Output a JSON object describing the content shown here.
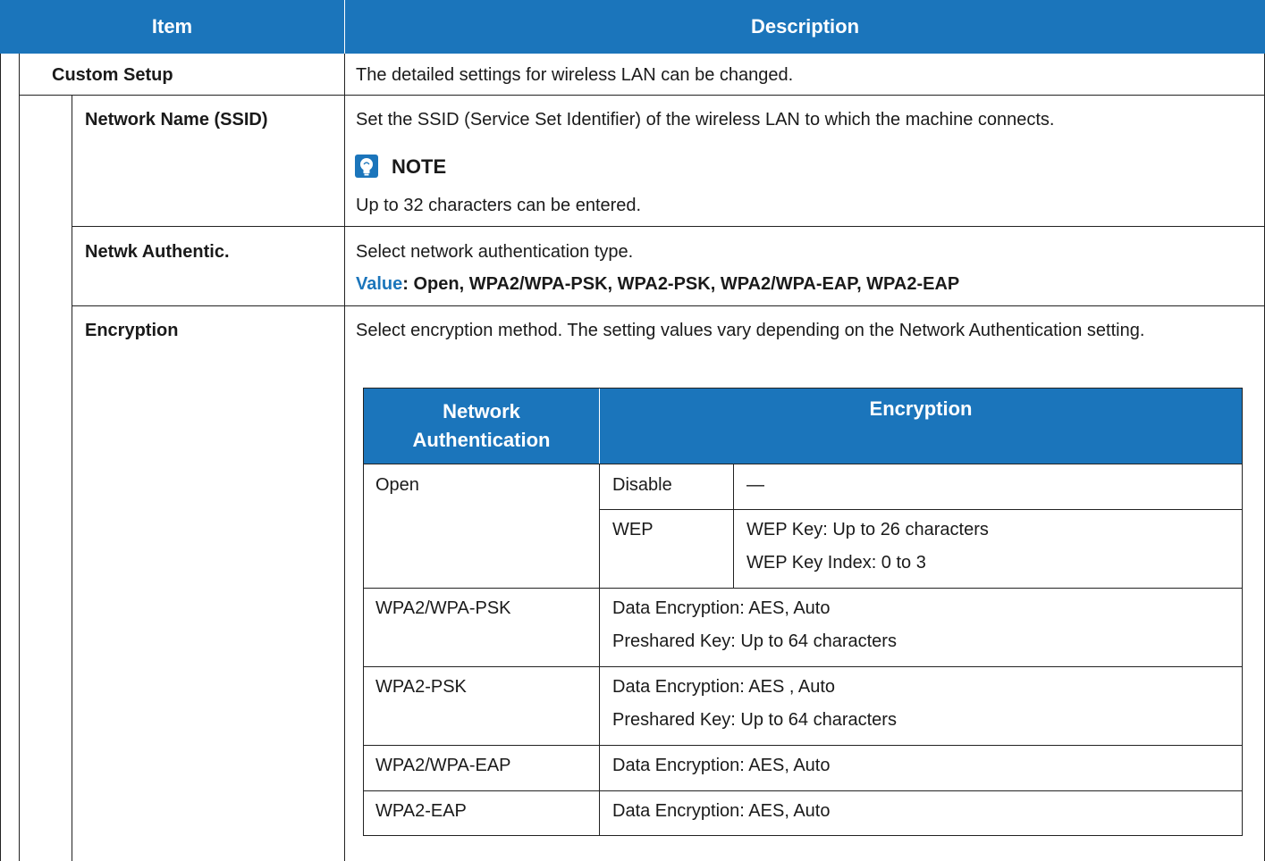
{
  "header": {
    "item": "Item",
    "description": "Description"
  },
  "rows": {
    "custom_setup": {
      "item": "Custom Setup",
      "desc": "The detailed settings for wireless LAN can be changed."
    },
    "ssid": {
      "item": "Network Name (SSID)",
      "desc": "Set the SSID (Service Set Identifier) of the wireless LAN to which the machine connects.",
      "note_title": "NOTE",
      "note_text": "Up to 32 characters can be entered.",
      "note_icon": "lightbulb-note-icon"
    },
    "auth": {
      "item": "Netwk Authentic.",
      "desc": "Select network authentication type.",
      "value_label": "Value",
      "value_text": ": Open, WPA2/WPA-PSK, WPA2-PSK, WPA2/WPA-EAP, WPA2-EAP"
    },
    "encryption": {
      "item": "Encryption",
      "desc": "Select encryption method. The setting values vary depending on the Network Authentication setting."
    }
  },
  "inner_table": {
    "head_auth": "Network Authentication",
    "head_enc": "Encryption",
    "open": "Open",
    "disable": "Disable",
    "dash": "—",
    "wep": "WEP",
    "wep_key": "WEP Key: Up to 26 characters",
    "wep_index": "WEP Key Index: 0 to 3",
    "wpa_psk": "WPA2/WPA-PSK",
    "wpa_psk_1": "Data Encryption: AES, Auto",
    "wpa_psk_2": "Preshared Key: Up to 64 characters",
    "wpa2_psk": "WPA2-PSK",
    "wpa2_psk_1": "Data Encryption: AES , Auto",
    "wpa2_psk_2": "Preshared Key: Up to 64 characters",
    "wpa_eap": "WPA2/WPA-EAP",
    "wpa_eap_1": "Data Encryption: AES, Auto",
    "wpa2_eap": "WPA2-EAP",
    "wpa2_eap_1": "Data Encryption: AES, Auto"
  },
  "colors": {
    "header_blue": "#1b75bb",
    "border": "#222222"
  }
}
